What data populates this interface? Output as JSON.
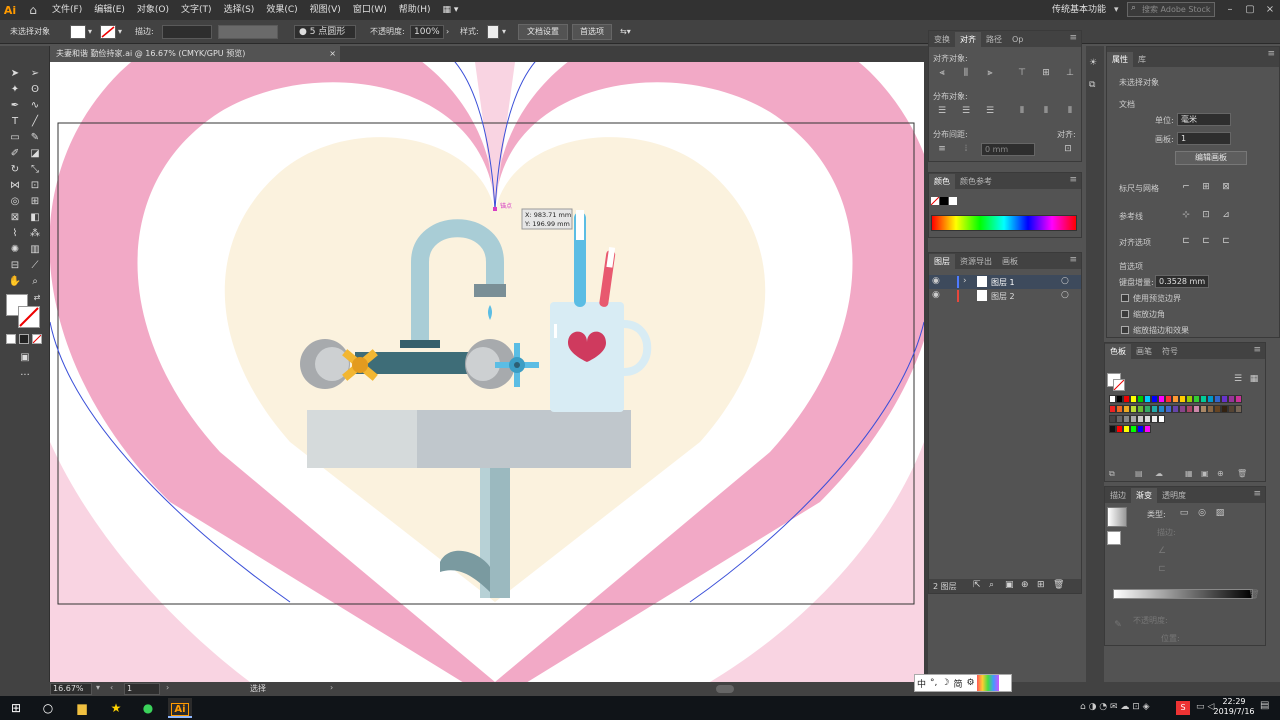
{
  "menubar": {
    "app_icon": "Ai",
    "items": [
      "文件(F)",
      "编辑(E)",
      "对象(O)",
      "文字(T)",
      "选择(S)",
      "效果(C)",
      "视图(V)",
      "窗口(W)",
      "帮助(H)"
    ],
    "workspace": "传统基本功能",
    "search_placeholder": "搜索 Adobe Stock"
  },
  "controlbar": {
    "selection_status": "未选择对象",
    "stroke_label": "描边:",
    "brush_label": "5 点圆形",
    "opacity_label": "不透明度:",
    "opacity_value": "100%",
    "style_label": "样式:",
    "doc_setup_button": "文档设置",
    "preferences_button": "首选项"
  },
  "document_tab": {
    "title": "夫妻和谐 勤俭持家.ai @ 16.67% (CMYK/GPU 预览)",
    "close": "×"
  },
  "canvas": {
    "tooltip_x": "X: 983.71 mm",
    "tooltip_y": "Y: 196.99 mm",
    "anchor_label": "锚点",
    "colors": {
      "pink": "#f2a9c6",
      "light_pink": "#f9d4e2",
      "cream": "#fbf2de",
      "pipe": "#a9cdd6",
      "blue": "#5bbde4",
      "red_toothbrush": "#e8596f",
      "heart_red": "#cf3a5e",
      "yellow_handle": "#f2b632",
      "sink": "#c0c7cc"
    }
  },
  "align_panel": {
    "tabs": [
      "变换",
      "对齐",
      "路径",
      "Op"
    ],
    "align_objects_label": "对齐对象:",
    "distribute_objects_label": "分布对象:",
    "distribute_spacing_label": "分布间距:",
    "align_to_label": "对齐:",
    "spacing_value": "0 mm"
  },
  "color_panel": {
    "tabs": [
      "颜色",
      "颜色参考"
    ]
  },
  "layers_panel": {
    "tabs": [
      "图层",
      "资源导出",
      "画板"
    ],
    "layers": [
      {
        "name": "图层 1",
        "color": "#4f7bff"
      },
      {
        "name": "图层 2",
        "color": "#e8473c"
      }
    ],
    "footer": "2 图层"
  },
  "properties_panel": {
    "tabs": [
      "属性",
      "库"
    ],
    "no_selection": "未选择对象",
    "document_label": "文档",
    "units_label": "单位:",
    "units_value": "毫米",
    "artboard_label": "画板:",
    "artboard_value": "1",
    "edit_artboards_button": "编辑画板",
    "rulers_grids_label": "标尺与网格",
    "guides_label": "参考线",
    "align_options_label": "对齐选项",
    "preferences_label": "首选项",
    "keyboard_increment_label": "键盘增量:",
    "keyboard_increment_value": "0.3528 mm",
    "options": [
      "使用预览边界",
      "缩放边角",
      "缩放描边和效果"
    ]
  },
  "swatches_panel": {
    "tabs": [
      "色板",
      "画笔",
      "符号"
    ]
  },
  "gradient_panel": {
    "tabs": [
      "描边",
      "渐变",
      "透明度"
    ],
    "type_label": "类型:",
    "stroke_label": "描边:",
    "opacity_label": "不透明度:",
    "location_label": "位置:"
  },
  "statusbar": {
    "zoom": "16.67%",
    "artboard": "1",
    "tool": "选择"
  },
  "ime_bar": {
    "items": [
      "中",
      "°,",
      "☽",
      "简",
      "⚙"
    ]
  },
  "taskbar": {
    "time": "22:29",
    "date": "2019/7/16"
  }
}
